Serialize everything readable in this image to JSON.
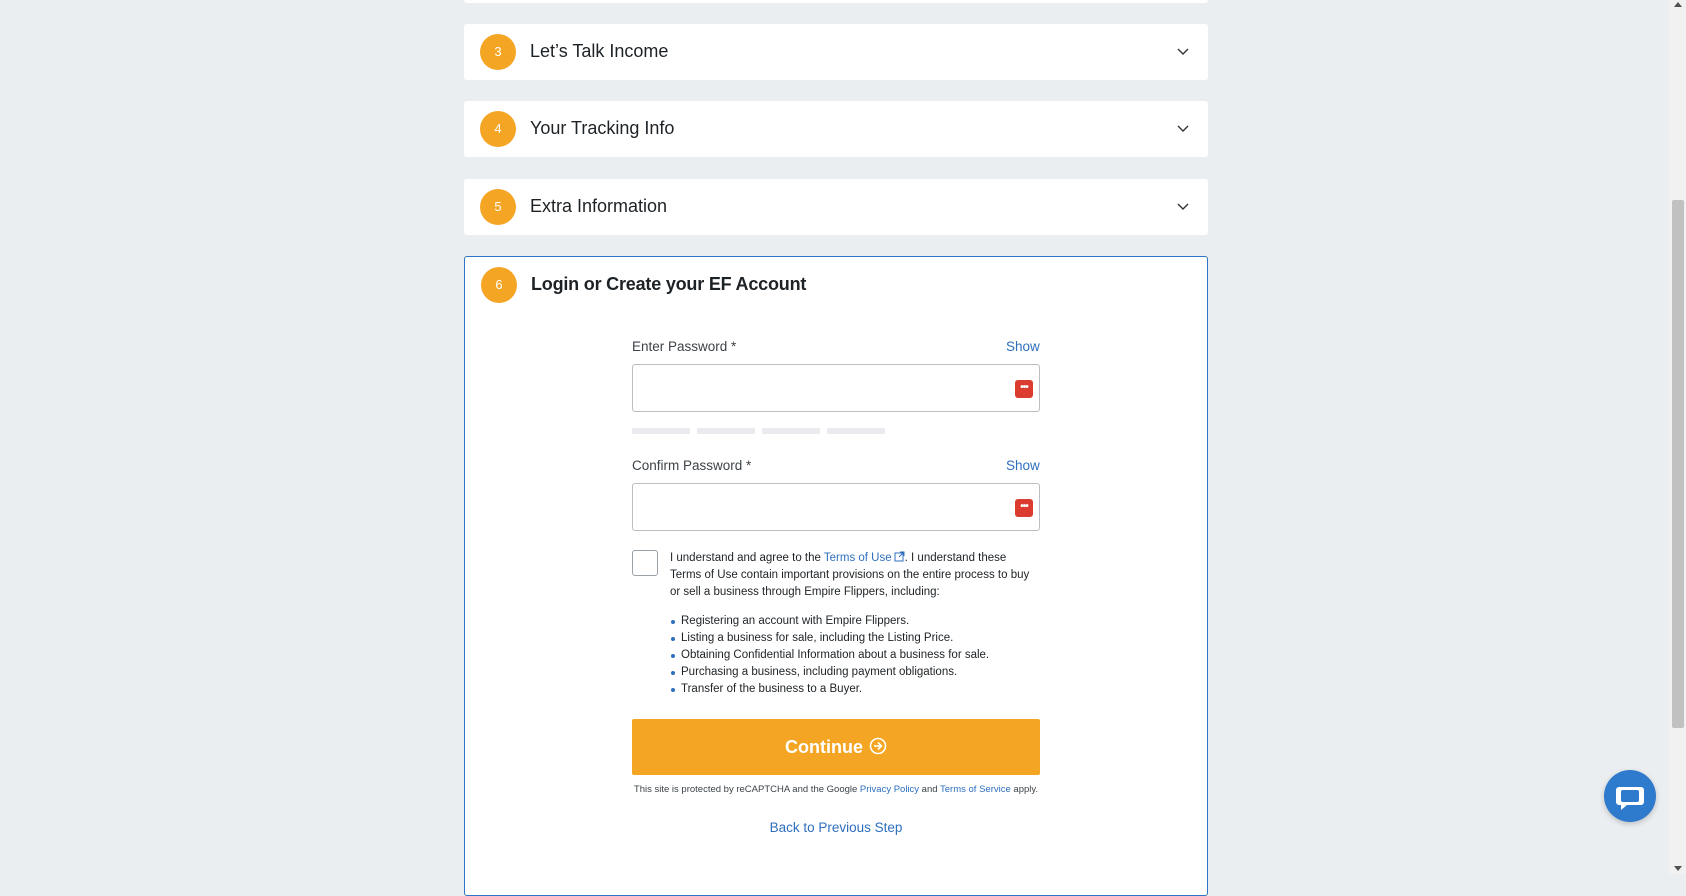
{
  "steps": [
    {
      "number": "3",
      "title": "Let’s Talk Income"
    },
    {
      "number": "4",
      "title": "Your Tracking Info"
    },
    {
      "number": "5",
      "title": "Extra Information"
    }
  ],
  "active_step": {
    "number": "6",
    "title": "Login or Create your EF Account"
  },
  "password": {
    "label": "Enter Password *",
    "show_label": "Show",
    "value": ""
  },
  "confirm_password": {
    "label": "Confirm Password *",
    "show_label": "Show",
    "value": ""
  },
  "terms": {
    "text_before": "I understand and agree to the ",
    "link_text": "Terms of Use",
    "text_after": ". I understand these Terms of Use contain important provisions on the entire process to buy or sell a business through Empire Flippers, including:",
    "items": [
      "Registering an account with Empire Flippers.",
      "Listing a business for sale, including the Listing Price.",
      "Obtaining Confidential Information about a business for sale.",
      "Purchasing a business, including payment obligations.",
      "Transfer of the business to a Buyer."
    ]
  },
  "continue_label": "Continue",
  "recaptcha": {
    "text_before": "This site is protected by reCAPTCHA and the Google ",
    "privacy_link": "Privacy Policy",
    "and_text": " and ",
    "terms_link": "Terms of Service",
    "text_after": " apply."
  },
  "back_label": "Back to Previous Step",
  "colors": {
    "accent": "#f4a523",
    "link": "#2e6fbe",
    "active_border": "#2e75c7",
    "chat": "#2e7acc"
  }
}
